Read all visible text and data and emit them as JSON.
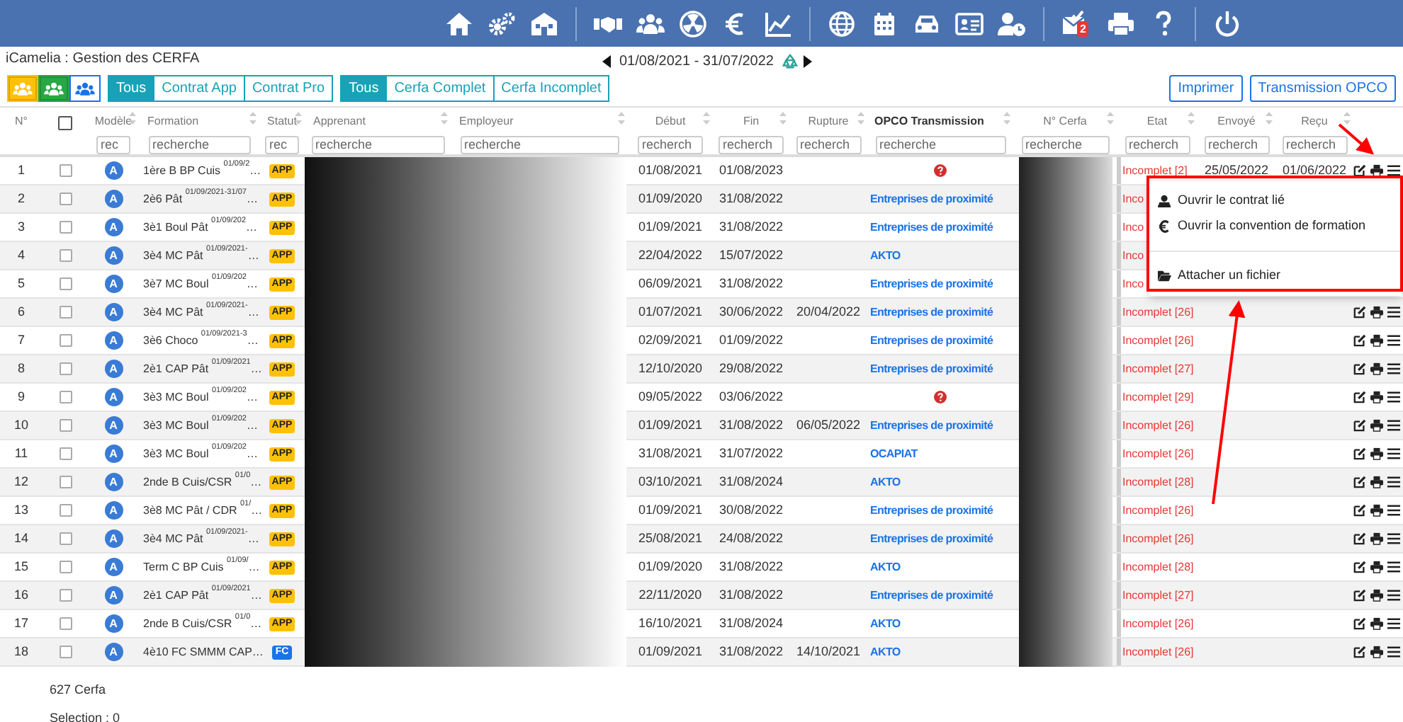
{
  "nav": {
    "mail_badge": "2"
  },
  "header": {
    "title": "iCamelia : Gestion des CERFA",
    "period": "01/08/2021 - 31/07/2022"
  },
  "filters": {
    "role_buttons": [
      {
        "kind": "yellow",
        "selected": true
      },
      {
        "kind": "green",
        "selected": true
      },
      {
        "kind": "outline",
        "selected": false
      }
    ],
    "contract": [
      {
        "label": "Tous",
        "selected": true
      },
      {
        "label": "Contrat App",
        "selected": false
      },
      {
        "label": "Contrat Pro",
        "selected": false
      }
    ],
    "cerfa": [
      {
        "label": "Tous",
        "selected": true
      },
      {
        "label": "Cerfa Complet",
        "selected": false
      },
      {
        "label": "Cerfa Incomplet",
        "selected": false
      }
    ],
    "actions": [
      "Imprimer",
      "Transmission OPCO"
    ]
  },
  "table": {
    "columns": [
      {
        "label": "N°",
        "kind": "plain"
      },
      {
        "kind": "checkbox",
        "checked": false
      },
      {
        "label": "Modèle",
        "kind": "filter",
        "placeholder": "rec"
      },
      {
        "label": "Formation",
        "kind": "filter",
        "placeholder": "recherche"
      },
      {
        "label": "Statut",
        "kind": "filter",
        "placeholder": "rec"
      },
      {
        "label": "Apprenant",
        "kind": "filter",
        "placeholder": "recherche"
      },
      {
        "label": "Employeur",
        "kind": "filter",
        "placeholder": "recherche"
      },
      {
        "label": "Début",
        "kind": "filter",
        "placeholder": "recherch"
      },
      {
        "label": "Fin",
        "kind": "filter",
        "placeholder": "recherch"
      },
      {
        "label": "Rupture",
        "kind": "filter",
        "placeholder": "recherch"
      },
      {
        "label": "OPCO Transmission",
        "kind": "filter",
        "placeholder": "recherche"
      },
      {
        "label": "N° Cerfa",
        "kind": "filter",
        "placeholder": "recherche"
      },
      {
        "label": "Etat",
        "kind": "filter",
        "placeholder": "recherch"
      },
      {
        "label": "Envoyé",
        "kind": "filter",
        "placeholder": "recherch"
      },
      {
        "label": "Reçu",
        "kind": "filter",
        "placeholder": "recherch"
      }
    ],
    "rows": [
      {
        "n": "1",
        "checked": false,
        "model": "A",
        "formation": "1ère B BP Cuis $^{01/09/2}$…",
        "statut": {
          "text": "APP",
          "color": "#ffc107"
        },
        "debut": "01/08/2021",
        "fin": "01/08/2023",
        "opco": {
          "kind": "alert"
        },
        "etat": "Incomplet [2]",
        "envoye": "25/05/2022",
        "recu": "01/06/2022"
      },
      {
        "n": "2",
        "checked": false,
        "model": "A",
        "formation": "2è6 Pât $^{01/09/2021-31/07}$…",
        "statut": {
          "text": "APP",
          "color": "#ffc107"
        },
        "debut": "01/09/2020",
        "fin": "31/08/2022",
        "opco": {
          "kind": "link",
          "text": "Entreprises de proximité"
        },
        "etat": "Inco"
      },
      {
        "n": "3",
        "checked": false,
        "model": "A",
        "formation": "3è1 Boul Pât $^{01/09/202}$…",
        "statut": {
          "text": "APP",
          "color": "#ffc107"
        },
        "debut": "01/09/2021",
        "fin": "31/08/2022",
        "opco": {
          "kind": "link",
          "text": "Entreprises de proximité"
        },
        "etat": "Inco"
      },
      {
        "n": "4",
        "checked": false,
        "model": "A",
        "formation": "3è4 MC Pât $^{01/09/2021-}$…",
        "statut": {
          "text": "APP",
          "color": "#ffc107"
        },
        "debut": "22/04/2022",
        "fin": "15/07/2022",
        "opco": {
          "kind": "link",
          "text": "AKTO"
        },
        "etat": "Inco"
      },
      {
        "n": "5",
        "checked": false,
        "model": "A",
        "formation": "3è7 MC Boul $^{01/09/202}$…",
        "statut": {
          "text": "APP",
          "color": "#ffc107"
        },
        "debut": "06/09/2021",
        "fin": "31/08/2022",
        "opco": {
          "kind": "link",
          "text": "Entreprises de proximité"
        },
        "etat": "Inco"
      },
      {
        "n": "6",
        "checked": false,
        "model": "A",
        "formation": "3è4 MC Pât $^{01/09/2021-}$…",
        "statut": {
          "text": "APP",
          "color": "#ffc107"
        },
        "debut": "01/07/2021",
        "fin": "30/06/2022",
        "rupture": "20/04/2022",
        "opco": {
          "kind": "link",
          "text": "Entreprises de proximité"
        },
        "etat": "Incomplet [26]"
      },
      {
        "n": "7",
        "checked": false,
        "model": "A",
        "formation": "3è6 Choco $^{01/09/2021-3}$…",
        "statut": {
          "text": "APP",
          "color": "#ffc107"
        },
        "debut": "02/09/2021",
        "fin": "01/09/2022",
        "opco": {
          "kind": "link",
          "text": "Entreprises de proximité"
        },
        "etat": "Incomplet [26]"
      },
      {
        "n": "8",
        "checked": false,
        "model": "A",
        "formation": "2è1 CAP Pât $^{01/09/2021}$…",
        "statut": {
          "text": "APP",
          "color": "#ffc107"
        },
        "debut": "12/10/2020",
        "fin": "29/08/2022",
        "opco": {
          "kind": "link",
          "text": "Entreprises de proximité"
        },
        "etat": "Incomplet [27]"
      },
      {
        "n": "9",
        "checked": false,
        "model": "A",
        "formation": "3è3 MC Boul $^{01/09/202}$…",
        "statut": {
          "text": "APP",
          "color": "#ffc107"
        },
        "debut": "09/05/2022",
        "fin": "03/06/2022",
        "opco": {
          "kind": "alert"
        },
        "etat": "Incomplet [29]"
      },
      {
        "n": "10",
        "checked": false,
        "model": "A",
        "formation": "3è3 MC Boul $^{01/09/202}$…",
        "statut": {
          "text": "APP",
          "color": "#ffc107"
        },
        "debut": "01/09/2021",
        "fin": "31/08/2022",
        "rupture": "06/05/2022",
        "opco": {
          "kind": "link",
          "text": "Entreprises de proximité"
        },
        "etat": "Incomplet [26]"
      },
      {
        "n": "11",
        "checked": false,
        "model": "A",
        "formation": "3è3 MC Boul $^{01/09/202}$…",
        "statut": {
          "text": "APP",
          "color": "#ffc107"
        },
        "debut": "31/08/2021",
        "fin": "31/07/2022",
        "opco": {
          "kind": "link",
          "text": "OCAPIAT"
        },
        "etat": "Incomplet [26]"
      },
      {
        "n": "12",
        "checked": false,
        "model": "A",
        "formation": "2nde B Cuis/CSR $^{01/0}$…",
        "statut": {
          "text": "APP",
          "color": "#ffc107"
        },
        "debut": "03/10/2021",
        "fin": "31/08/2024",
        "opco": {
          "kind": "link",
          "text": "AKTO"
        },
        "etat": "Incomplet [28]"
      },
      {
        "n": "13",
        "checked": false,
        "model": "A",
        "formation": "3è8 MC Pât / CDR $^{01/}$…",
        "statut": {
          "text": "APP",
          "color": "#ffc107"
        },
        "debut": "01/09/2021",
        "fin": "30/08/2022",
        "opco": {
          "kind": "link",
          "text": "Entreprises de proximité"
        },
        "etat": "Incomplet [26]"
      },
      {
        "n": "14",
        "checked": false,
        "model": "A",
        "formation": "3è4 MC Pât $^{01/09/2021-}$…",
        "statut": {
          "text": "APP",
          "color": "#ffc107"
        },
        "debut": "25/08/2021",
        "fin": "24/08/2022",
        "opco": {
          "kind": "link",
          "text": "Entreprises de proximité"
        },
        "etat": "Incomplet [26]"
      },
      {
        "n": "15",
        "checked": false,
        "model": "A",
        "formation": "Term C BP Cuis $^{01/09/}$…",
        "statut": {
          "text": "APP",
          "color": "#ffc107"
        },
        "debut": "01/09/2020",
        "fin": "31/08/2022",
        "opco": {
          "kind": "link",
          "text": "AKTO"
        },
        "etat": "Incomplet [28]"
      },
      {
        "n": "16",
        "checked": false,
        "model": "A",
        "formation": "2è1 CAP Pât $^{01/09/2021}$…",
        "statut": {
          "text": "APP",
          "color": "#ffc107"
        },
        "debut": "22/11/2020",
        "fin": "31/08/2022",
        "opco": {
          "kind": "link",
          "text": "Entreprises de proximité"
        },
        "etat": "Incomplet [27]"
      },
      {
        "n": "17",
        "checked": false,
        "model": "A",
        "formation": "2nde B Cuis/CSR $^{01/0}$…",
        "statut": {
          "text": "APP",
          "color": "#ffc107"
        },
        "debut": "16/10/2021",
        "fin": "31/08/2024",
        "opco": {
          "kind": "link",
          "text": "AKTO"
        },
        "etat": "Incomplet [26]"
      },
      {
        "n": "18",
        "checked": false,
        "model": "A",
        "formation": "4è10 FC SMMM CAP…",
        "statut": {
          "text": "FC",
          "color": "#1a73e8"
        },
        "debut": "01/09/2021",
        "fin": "31/08/2022",
        "rupture": "14/10/2021",
        "opco": {
          "kind": "link",
          "text": "AKTO"
        },
        "etat": "Incomplet [26]"
      }
    ]
  },
  "context_menu": {
    "items": [
      {
        "kind": "contract",
        "label": "Ouvrir le contrat lié"
      },
      {
        "kind": "euro",
        "label": "Ouvrir la convention de formation"
      },
      {
        "kind": "divider"
      },
      {
        "kind": "folder",
        "label": "Attacher un fichier"
      }
    ]
  },
  "footer": {
    "count": "627 Cerfa",
    "selection": "Selection : 0"
  }
}
